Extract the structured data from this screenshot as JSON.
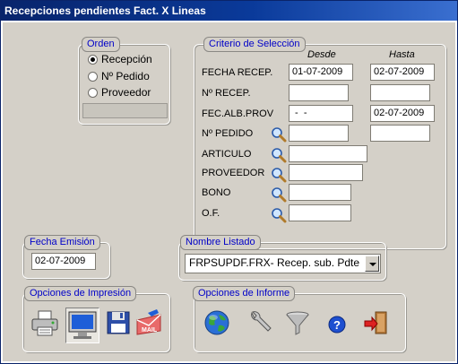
{
  "window": {
    "title": "Recepciones pendientes Fact. X Lineas"
  },
  "orden": {
    "legend": "Orden",
    "options": [
      {
        "label": "Recepción",
        "selected": true
      },
      {
        "label": "Nº Pedido",
        "selected": false
      },
      {
        "label": "Proveedor",
        "selected": false
      }
    ]
  },
  "criterio": {
    "legend": "Criterio de Selección",
    "col_desde": "Desde",
    "col_hasta": "Hasta",
    "rows": [
      {
        "label": "FECHA RECEP.",
        "desde": "01-07-2009",
        "hasta": "02-07-2009"
      },
      {
        "label": "Nº RECEP.",
        "desde": "",
        "hasta": ""
      },
      {
        "label": "FEC.ALB.PROV",
        "desde": " -  -",
        "hasta": "02-07-2009"
      },
      {
        "label": "Nº PEDIDO",
        "desde": "",
        "hasta": ""
      },
      {
        "label": "ARTICULO",
        "desde": ""
      },
      {
        "label": "PROVEEDOR",
        "desde": ""
      },
      {
        "label": "BONO",
        "desde": ""
      },
      {
        "label": "O.F.",
        "desde": ""
      }
    ]
  },
  "fecha_emision": {
    "legend": "Fecha Emisión",
    "value": "02-07-2009"
  },
  "nombre_listado": {
    "legend": "Nombre Listado",
    "value": "FRPSUPDF.FRX- Recep. sub. Pdte"
  },
  "opciones_impresion": {
    "legend": "Opciones de Impresión"
  },
  "opciones_informe": {
    "legend": "Opciones de Informe"
  },
  "icons": [
    "printer-icon",
    "monitor-icon",
    "floppy-disk-icon",
    "mail-icon",
    "globe-icon",
    "wrench-icon",
    "funnel-icon",
    "help-icon",
    "exit-door-icon",
    "magnifier-icon"
  ],
  "colors": {
    "title_bar": "#0a246a",
    "legend_text": "#0000c8",
    "panel": "#d4d0c8"
  }
}
